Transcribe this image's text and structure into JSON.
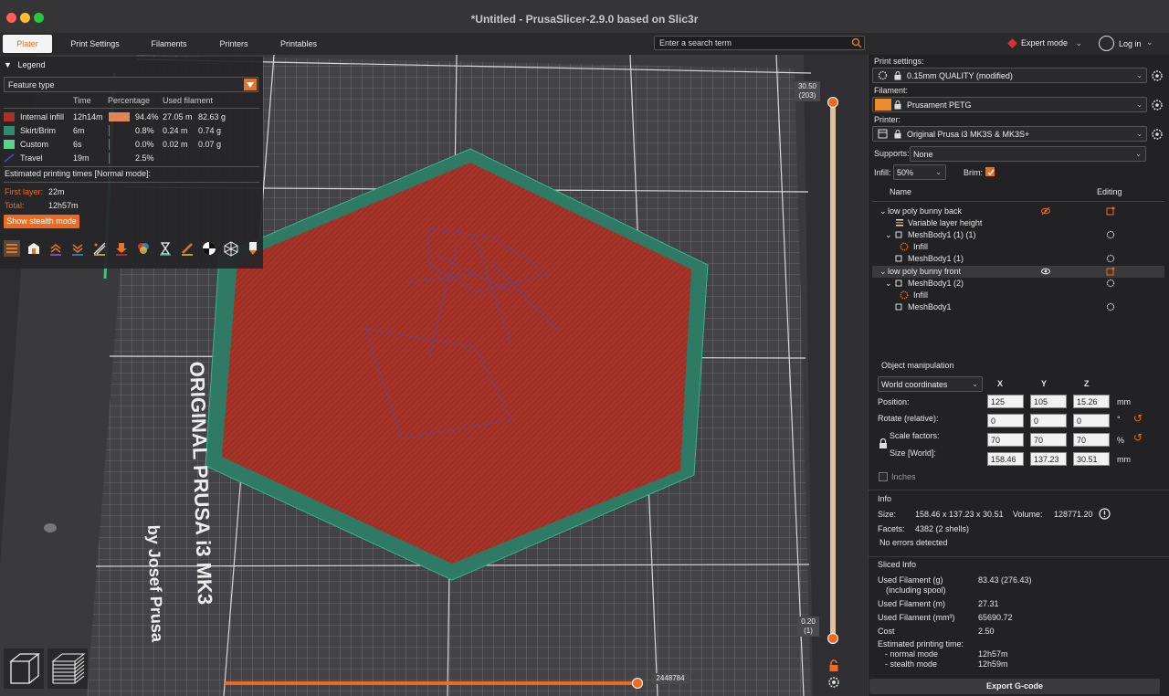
{
  "window": {
    "title": "*Untitled - PrusaSlicer-2.9.0 based on Slic3r"
  },
  "tabs": [
    {
      "label": "Plater"
    },
    {
      "label": "Print Settings"
    },
    {
      "label": "Filaments"
    },
    {
      "label": "Printers"
    },
    {
      "label": "Printables"
    }
  ],
  "search": {
    "placeholder": "Enter a search term"
  },
  "header": {
    "mode_label": "Expert mode",
    "login_label": "Log in"
  },
  "legend": {
    "title": "Legend",
    "feature_select": "Feature type",
    "columns": {
      "time": "Time",
      "percentage": "Percentage",
      "used_filament": "Used filament"
    },
    "rows": [
      {
        "name": "Internal infill",
        "time": "12h14m",
        "pct": "94.4%",
        "pct_value": 94.4,
        "meters": "27.05 m",
        "grams": "82.63 g",
        "color": "#a8322a"
      },
      {
        "name": "Skirt/Brim",
        "time": "6m",
        "pct": "0.8%",
        "pct_value": 0.8,
        "meters": "0.24 m",
        "grams": "0.74 g",
        "color": "#2f8c6e"
      },
      {
        "name": "Custom",
        "time": "6s",
        "pct": "0.0%",
        "pct_value": 0.0,
        "meters": "0.02 m",
        "grams": "0.07 g",
        "color": "#5cd08f"
      },
      {
        "name": "Travel",
        "time": "19m",
        "pct": "2.5%",
        "pct_value": 2.5,
        "meters": "",
        "grams": "",
        "color": "#3a4fd0"
      }
    ],
    "est_title": "Estimated printing times [Normal mode]:",
    "first_layer_label": "First layer:",
    "first_layer_value": "22m",
    "total_label": "Total:",
    "total_value": "12h57m",
    "stealth_button": "Show stealth mode"
  },
  "bed": {
    "text_line1": "ORIGINAL PRUSA i3 MK3",
    "text_line2": "by Josef Prusa"
  },
  "sliders": {
    "top_value": "30.50",
    "top_layer": "(203)",
    "bottom_value": "0.20",
    "bottom_layer": "(1)",
    "horizontal_value": "2448784"
  },
  "sidebar": {
    "print_settings_label": "Print settings:",
    "print_settings_value": "0.15mm QUALITY (modified)",
    "filament_label": "Filament:",
    "filament_value": "Prusament PETG",
    "filament_color": "#ed8a2e",
    "printer_label": "Printer:",
    "printer_value": "Original Prusa i3 MK3S & MK3S+",
    "supports_label": "Supports:",
    "supports_value": "None",
    "infill_label": "Infill:",
    "infill_value": "50%",
    "brim_label": "Brim:",
    "brim_checked": true,
    "list_headers": {
      "name": "Name",
      "editing": "Editing"
    },
    "objects": [
      {
        "label": "low poly bunny back"
      },
      {
        "label": "Variable layer height"
      },
      {
        "label": "MeshBody1 (1) (1)"
      },
      {
        "label": "Infill"
      },
      {
        "label": "MeshBody1 (1)"
      },
      {
        "label": "low poly bunny front"
      },
      {
        "label": "MeshBody1 (2)"
      },
      {
        "label": "Infill"
      },
      {
        "label": "MeshBody1"
      }
    ],
    "object_manipulation": {
      "title": "Object manipulation",
      "coordinates": "World coordinates",
      "axes": [
        "X",
        "Y",
        "Z"
      ],
      "position_label": "Position:",
      "position": [
        "125",
        "105",
        "15.26"
      ],
      "position_unit": "mm",
      "rotate_label": "Rotate (relative):",
      "rotate": [
        "0",
        "0",
        "0"
      ],
      "rotate_unit": "°",
      "scale_label": "Scale factors:",
      "scale": [
        "70",
        "70",
        "70"
      ],
      "scale_unit": "%",
      "size_label": "Size [World]:",
      "size": [
        "158.46",
        "137.23",
        "30.51"
      ],
      "size_unit": "mm",
      "inches_label": "Inches"
    },
    "info": {
      "title": "Info",
      "size_label": "Size:",
      "size_value": "158.46 x 137.23 x 30.51",
      "volume_label": "Volume:",
      "volume_value": "128771.20",
      "facets_label": "Facets:",
      "facets_value": "4382 (2 shells)",
      "errors": "No errors detected"
    },
    "sliced_info": {
      "title": "Sliced Info",
      "used_g_label": "Used Filament (g)",
      "used_g_sub": "(including spool)",
      "used_g_value": "83.43 (276.43)",
      "used_m_label": "Used Filament (m)",
      "used_m_value": "27.31",
      "used_mm3_label": "Used Filament (mm³)",
      "used_mm3_value": "65690.72",
      "cost_label": "Cost",
      "cost_value": "2.50",
      "est_label": "Estimated printing time:",
      "normal_label": "- normal mode",
      "normal_value": "12h57m",
      "stealth_label": "- stealth mode",
      "stealth_value": "12h59m"
    },
    "export_button": "Export G-code"
  },
  "colors": {
    "accent": "#ed6b21",
    "infill": "#a8322a",
    "brim": "#2f8c6e",
    "travel": "#3a4fd0"
  }
}
